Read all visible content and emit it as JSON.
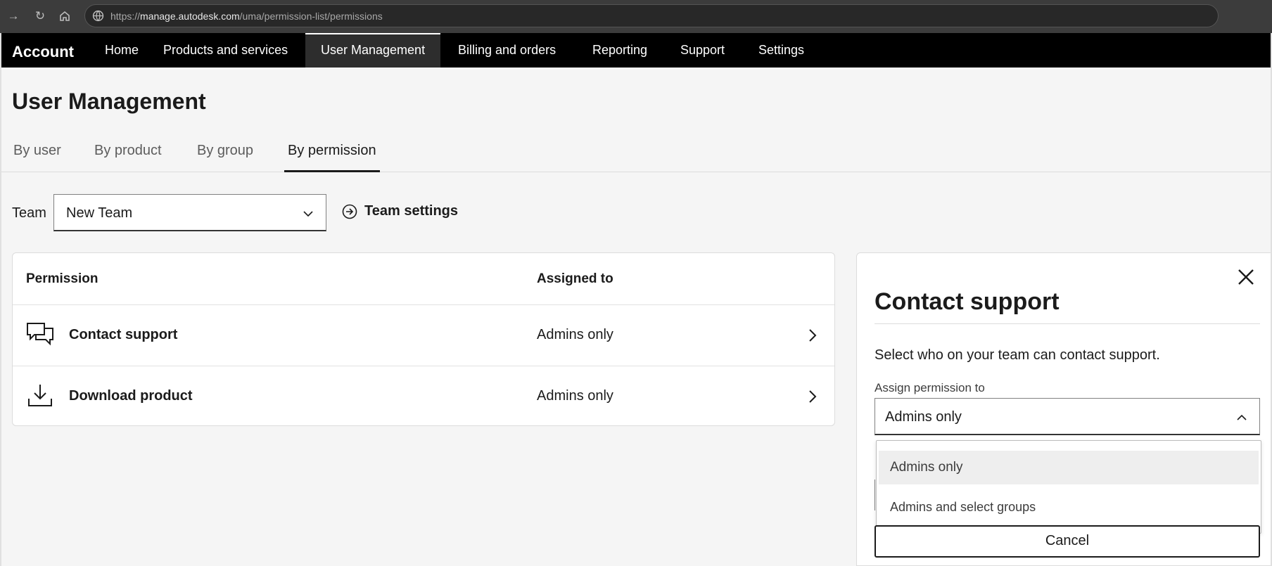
{
  "browser": {
    "url_prefix": "https://",
    "url_domain": "manage.autodesk.com",
    "url_path": "/uma/permission-list/permissions"
  },
  "app_nav": {
    "brand": "Account",
    "items": [
      {
        "label": "Home"
      },
      {
        "label": "Products and services"
      },
      {
        "label": "User Management"
      },
      {
        "label": "Billing and orders"
      },
      {
        "label": "Reporting"
      },
      {
        "label": "Support"
      },
      {
        "label": "Settings"
      }
    ],
    "active": "User Management"
  },
  "page": {
    "title": "User Management",
    "tabs": [
      {
        "label": "By user"
      },
      {
        "label": "By product"
      },
      {
        "label": "By group"
      },
      {
        "label": "By permission"
      }
    ],
    "active_tab": "By permission"
  },
  "team": {
    "label": "Team",
    "selected": "New Team",
    "settings_label": "Team settings"
  },
  "permissions_table": {
    "headers": {
      "permission": "Permission",
      "assigned_to": "Assigned to"
    },
    "rows": [
      {
        "icon": "chat-bubbles-icon",
        "name": "Contact support",
        "assigned": "Admins only"
      },
      {
        "icon": "download-icon",
        "name": "Download product",
        "assigned": "Admins only"
      }
    ]
  },
  "panel": {
    "title": "Contact support",
    "description": "Select who on your team can contact support.",
    "assign_label": "Assign permission to",
    "assign_value": "Admins only",
    "options": [
      "Admins only",
      "Admins and select groups"
    ],
    "cancel_label": "Cancel"
  },
  "colors": {
    "nav_bg": "#000000",
    "nav_active_bg": "#2d2d2d",
    "page_bg": "#f5f5f5",
    "option_selected_bg": "#eeeeee"
  }
}
